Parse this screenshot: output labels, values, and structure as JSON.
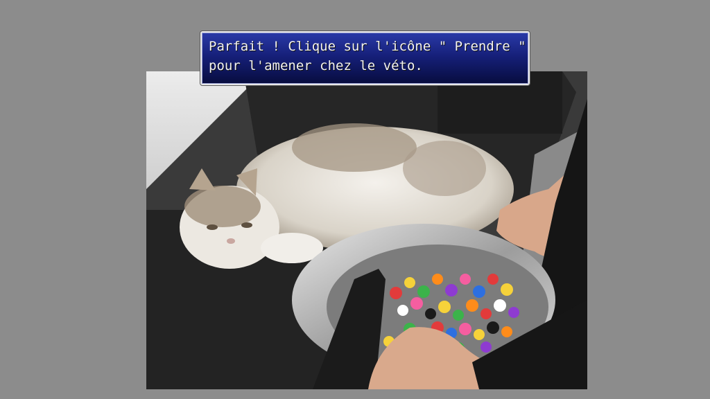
{
  "dialog": {
    "lines": [
      "Parfait ! Clique sur l'icône \" Prendre \"",
      "pour l'amener chez le véto."
    ]
  },
  "scene": {
    "subject": "cat-on-chair-with-candy-bowl"
  }
}
